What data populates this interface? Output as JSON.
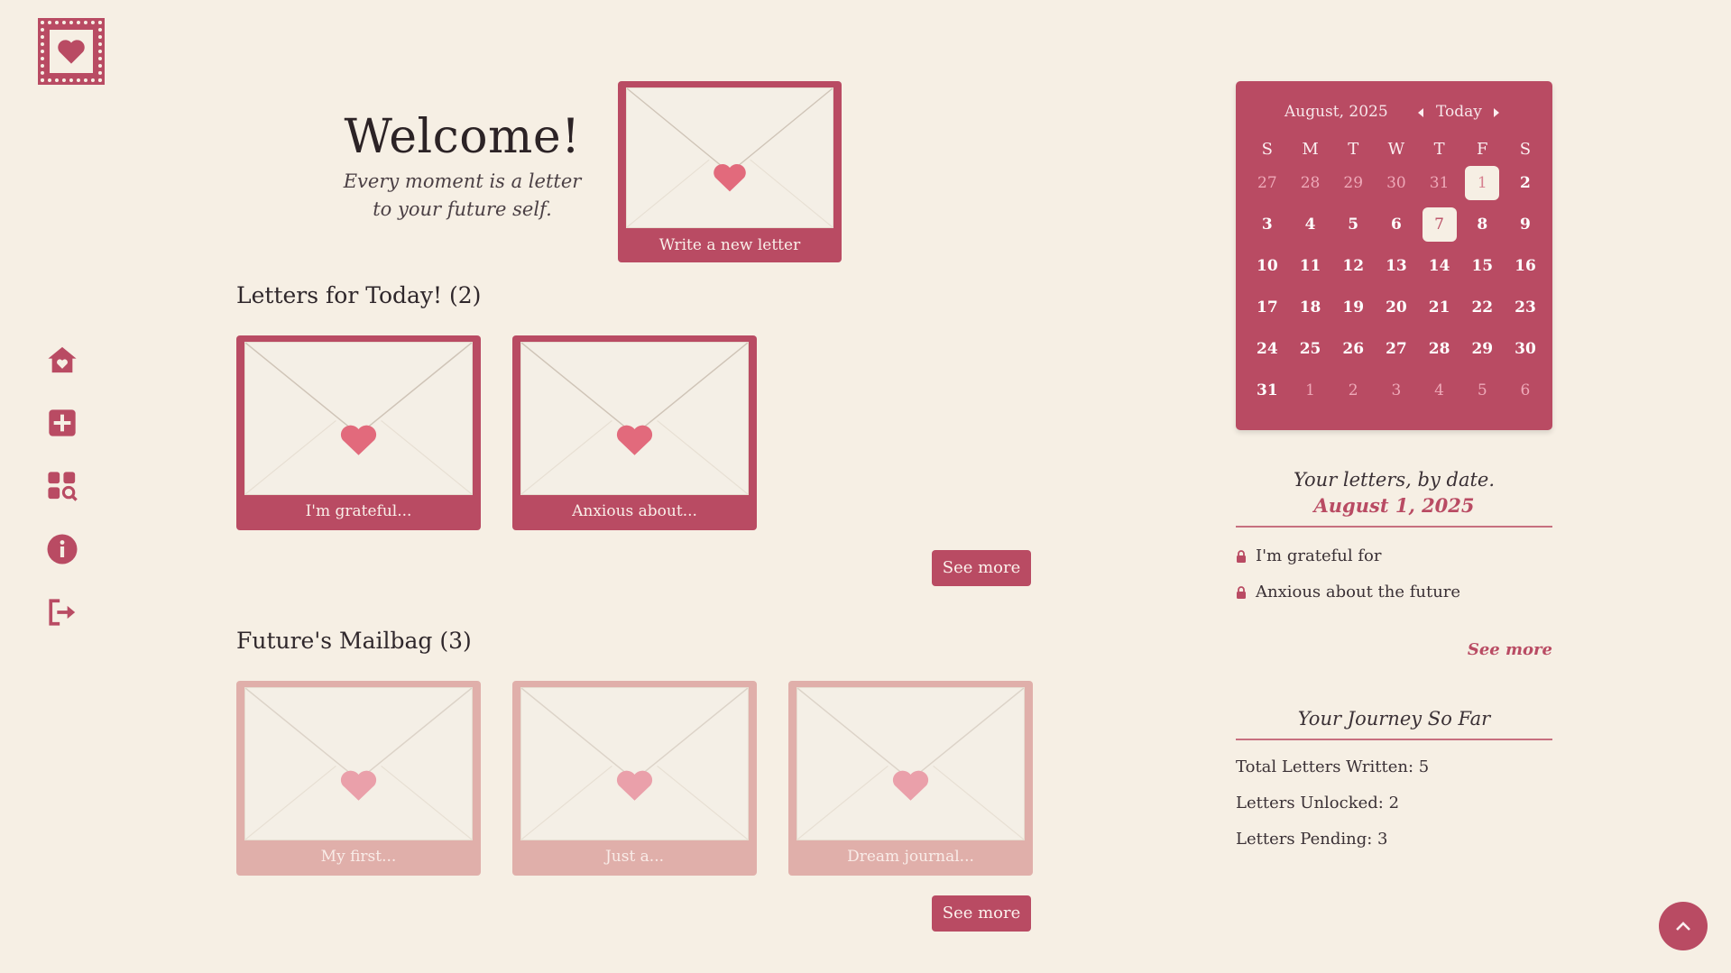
{
  "colors": {
    "accent": "#b94b63",
    "accent_light": "#e0afaa",
    "background": "#f6efe4"
  },
  "logo": {
    "icon": "heart-stamp-icon"
  },
  "sidebar": {
    "items": [
      {
        "icon": "home-heart-icon"
      },
      {
        "icon": "add-icon"
      },
      {
        "icon": "browse-letters-icon"
      },
      {
        "icon": "info-icon"
      },
      {
        "icon": "logout-icon"
      }
    ]
  },
  "welcome": {
    "title": "Welcome!",
    "subtitle": "Every moment is a letter to your future self."
  },
  "new_letter": {
    "label": "Write a new letter"
  },
  "today_section": {
    "title": "Letters for Today! (2)",
    "letters": [
      {
        "label": "I'm grateful..."
      },
      {
        "label": "Anxious about..."
      }
    ],
    "see_more": "See more"
  },
  "mailbag_section": {
    "title": "Future's Mailbag (3)",
    "letters": [
      {
        "label": "My first..."
      },
      {
        "label": "Just a..."
      },
      {
        "label": "Dream journal..."
      }
    ],
    "see_more": "See more"
  },
  "calendar": {
    "month_label": "August, 2025",
    "today_label": "Today",
    "weekdays": [
      "S",
      "M",
      "T",
      "W",
      "T",
      "F",
      "S"
    ],
    "weeks": [
      [
        {
          "d": "27",
          "m": true
        },
        {
          "d": "28",
          "m": true
        },
        {
          "d": "29",
          "m": true
        },
        {
          "d": "30",
          "m": true
        },
        {
          "d": "31",
          "m": true
        },
        {
          "d": "1",
          "sel": true
        },
        {
          "d": "2",
          "b": true
        }
      ],
      [
        {
          "d": "3",
          "b": true
        },
        {
          "d": "4",
          "b": true
        },
        {
          "d": "5",
          "b": true
        },
        {
          "d": "6",
          "b": true
        },
        {
          "d": "7",
          "sel": true,
          "today": true
        },
        {
          "d": "8",
          "b": true
        },
        {
          "d": "9",
          "b": true
        }
      ],
      [
        {
          "d": "10",
          "b": true
        },
        {
          "d": "11",
          "b": true
        },
        {
          "d": "12",
          "b": true
        },
        {
          "d": "13",
          "b": true
        },
        {
          "d": "14",
          "b": true
        },
        {
          "d": "15",
          "b": true
        },
        {
          "d": "16",
          "b": true
        }
      ],
      [
        {
          "d": "17",
          "b": true
        },
        {
          "d": "18",
          "b": true
        },
        {
          "d": "19",
          "b": true
        },
        {
          "d": "20",
          "b": true
        },
        {
          "d": "21",
          "b": true
        },
        {
          "d": "22",
          "b": true
        },
        {
          "d": "23",
          "b": true
        }
      ],
      [
        {
          "d": "24",
          "b": true
        },
        {
          "d": "25",
          "b": true
        },
        {
          "d": "26",
          "b": true
        },
        {
          "d": "27",
          "b": true
        },
        {
          "d": "28",
          "b": true
        },
        {
          "d": "29",
          "b": true
        },
        {
          "d": "30",
          "b": true
        }
      ],
      [
        {
          "d": "31",
          "b": true
        },
        {
          "d": "1",
          "m": true
        },
        {
          "d": "2",
          "m": true
        },
        {
          "d": "3",
          "m": true
        },
        {
          "d": "4",
          "m": true
        },
        {
          "d": "5",
          "m": true
        },
        {
          "d": "6",
          "m": true
        }
      ]
    ]
  },
  "by_date": {
    "title": "Your letters, by date.",
    "date": "August 1, 2025",
    "items": [
      {
        "label": "I'm grateful for",
        "icon": "lock-icon"
      },
      {
        "label": "Anxious about the future",
        "icon": "lock-icon"
      }
    ],
    "see_more": "See more"
  },
  "journey": {
    "title": "Your Journey So Far",
    "total": "Total Letters Written: 5",
    "unlocked": "Letters Unlocked: 2",
    "pending": "Letters Pending: 3"
  },
  "scroll_top": {
    "icon": "chevron-up-icon"
  }
}
